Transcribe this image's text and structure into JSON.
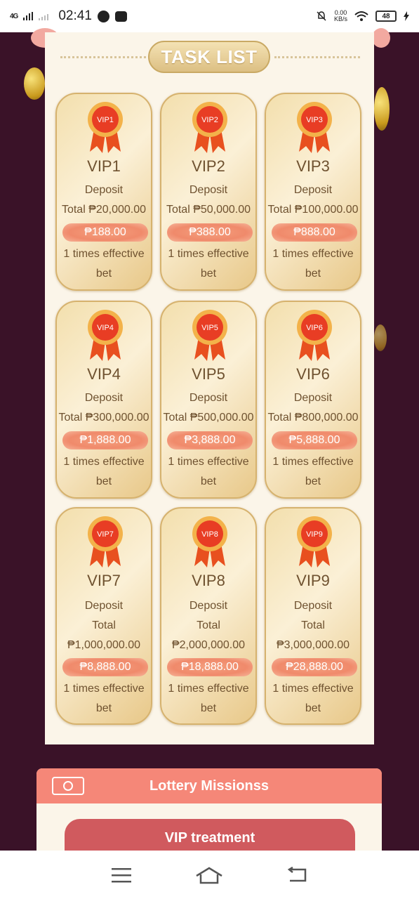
{
  "status_bar": {
    "network": "4G",
    "time": "02:41",
    "netspeed_value": "0.00",
    "netspeed_unit": "KB/s",
    "battery": "48"
  },
  "task_list": {
    "title": "TASK LIST",
    "cards": [
      {
        "badge": "VIP1",
        "name": "VIP1",
        "deposit": "Deposit",
        "total": "Total ₱20,000.00",
        "reward": "₱188.00",
        "bet1": "1 times effective",
        "bet2": "bet"
      },
      {
        "badge": "VIP2",
        "name": "VIP2",
        "deposit": "Deposit",
        "total": "Total ₱50,000.00",
        "reward": "₱388.00",
        "bet1": "1 times effective",
        "bet2": "bet"
      },
      {
        "badge": "VIP3",
        "name": "VIP3",
        "deposit": "Deposit",
        "total": "Total ₱100,000.00",
        "reward": "₱888.00",
        "bet1": "1 times effective",
        "bet2": "bet"
      },
      {
        "badge": "VIP4",
        "name": "VIP4",
        "deposit": "Deposit",
        "total": "Total ₱300,000.00",
        "reward": "₱1,888.00",
        "bet1": "1 times effective",
        "bet2": "bet"
      },
      {
        "badge": "VIP5",
        "name": "VIP5",
        "deposit": "Deposit",
        "total": "Total ₱500,000.00",
        "reward": "₱3,888.00",
        "bet1": "1 times effective",
        "bet2": "bet"
      },
      {
        "badge": "VIP6",
        "name": "VIP6",
        "deposit": "Deposit",
        "total": "Total ₱800,000.00",
        "reward": "₱5,888.00",
        "bet1": "1 times effective",
        "bet2": "bet"
      },
      {
        "badge": "VIP7",
        "name": "VIP7",
        "deposit": "Deposit",
        "total_label": "Total",
        "total_amount": "₱1,000,000.00",
        "reward": "₱8,888.00",
        "bet1": "1 times effective",
        "bet2": "bet"
      },
      {
        "badge": "VIP8",
        "name": "VIP8",
        "deposit": "Deposit",
        "total_label": "Total",
        "total_amount": "₱2,000,000.00",
        "reward": "₱18,888.00",
        "bet1": "1 times effective",
        "bet2": "bet"
      },
      {
        "badge": "VIP9",
        "name": "VIP9",
        "deposit": "Deposit",
        "total_label": "Total",
        "total_amount": "₱3,000,000.00",
        "reward": "₱28,888.00",
        "bet1": "1 times effective",
        "bet2": "bet"
      }
    ]
  },
  "lottery": {
    "title": "Lottery Missionss",
    "icon": "money-bill-icon",
    "vip_treatment": "VIP treatment"
  },
  "navbar": {
    "icons": [
      "menu-icon",
      "home-icon",
      "back-icon"
    ]
  },
  "colors": {
    "background": "#3a1228",
    "panel": "#fbf5e9",
    "lottery_header": "#f58778",
    "vip_treatment": "#d05a5e",
    "reward_pill": "#f08a6b"
  }
}
